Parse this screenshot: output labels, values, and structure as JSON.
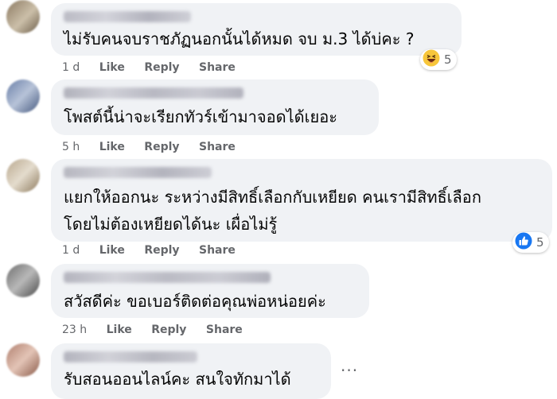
{
  "comments": [
    {
      "text_lines": [
        "ไม่รับคนจบราชภัฏนอกนั้นได้หมด จบ ม.3 ได้บ่คะ ?"
      ],
      "time": "1 d",
      "like": "Like",
      "reply": "Reply",
      "share": "Share",
      "reaction": {
        "icon": "haha-emoji-icon",
        "count": "5"
      }
    },
    {
      "text_lines": [
        "โพสต์นี้น่าจะเรียกทัวร์เข้ามาจอดได้เยอะ"
      ],
      "time": "5 h",
      "like": "Like",
      "reply": "Reply",
      "share": "Share"
    },
    {
      "text_lines": [
        "แยกให้ออกนะ ระหว่างมีสิทธิ์เลือกกับเหยียด คนเรามีสิทธิ์เลือก",
        "โดยไม่ต้องเหยียดได้นะ เผื่อไม่รู้"
      ],
      "time": "1 d",
      "like": "Like",
      "reply": "Reply",
      "share": "Share",
      "reaction": {
        "icon": "like-thumb-icon",
        "count": "5"
      }
    },
    {
      "text_lines": [
        "สวัสดีค่ะ ขอเบอร์ติดต่อคุณพ่อหน่อยค่ะ"
      ],
      "time": "23 h",
      "like": "Like",
      "reply": "Reply",
      "share": "Share"
    },
    {
      "text_lines": [
        "รับสอนออนไลน์คะ สนใจทักมาได้"
      ],
      "more": "···"
    }
  ],
  "colors": {
    "bubble": "#f0f2f5",
    "meta": "#65676b",
    "like_blue": "#1877f2",
    "haha_yellow": "#f7c63b"
  }
}
